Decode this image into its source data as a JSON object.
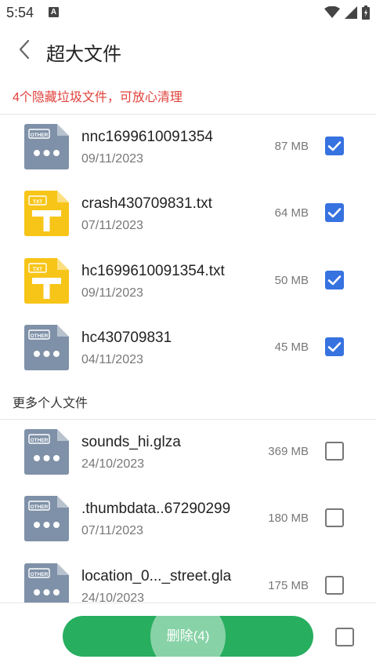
{
  "status": {
    "time": "5:54",
    "notif_letter": "A"
  },
  "header": {
    "title": "超大文件"
  },
  "hint": "4个隐藏垃圾文件，可放心清理",
  "section_title": "更多个人文件",
  "hidden_files": [
    {
      "type": "other",
      "icon_label": "OTHER",
      "name": "nnc1699610091354",
      "date": "09/11/2023",
      "size": "87 MB",
      "checked": true
    },
    {
      "type": "txt",
      "icon_label": "TXT",
      "name": "crash430709831.txt",
      "date": "07/11/2023",
      "size": "64 MB",
      "checked": true
    },
    {
      "type": "txt",
      "icon_label": "TXT",
      "name": "hc1699610091354.txt",
      "date": "09/11/2023",
      "size": "50 MB",
      "checked": true
    },
    {
      "type": "other",
      "icon_label": "OTHER",
      "name": "hc430709831",
      "date": "04/11/2023",
      "size": "45 MB",
      "checked": true
    }
  ],
  "personal_files": [
    {
      "type": "other",
      "icon_label": "OTHER",
      "name": "sounds_hi.glza",
      "date": "24/10/2023",
      "size": "369 MB",
      "checked": false
    },
    {
      "type": "other",
      "icon_label": "OTHER",
      "name": ".thumbdata..67290299",
      "date": "07/11/2023",
      "size": "180 MB",
      "checked": false
    },
    {
      "type": "other",
      "icon_label": "OTHER",
      "name": "location_0..._street.gla",
      "date": "24/10/2023",
      "size": "175 MB",
      "checked": false
    }
  ],
  "bottom": {
    "delete_label": "删除(4)",
    "select_all_checked": false
  },
  "colors": {
    "accent": "#3672e0",
    "delete_green": "#27ae5f",
    "hint_red": "#e0413b",
    "txt_yellow": "#f7c518",
    "other_gray": "#7f91a8"
  }
}
